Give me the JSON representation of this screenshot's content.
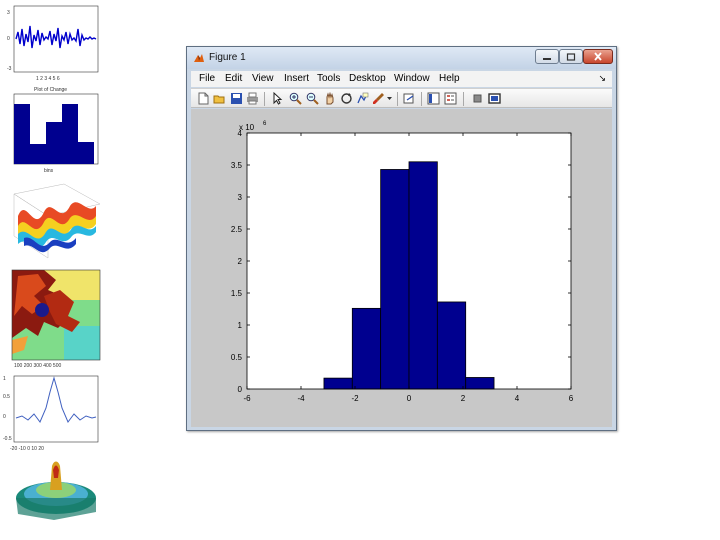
{
  "window": {
    "title": "Figure 1",
    "controls": {
      "minimize": "minimize",
      "maximize": "maximize",
      "close": "close"
    }
  },
  "menu": {
    "items": [
      "File",
      "Edit",
      "View",
      "Insert",
      "Tools",
      "Desktop",
      "Window",
      "Help"
    ],
    "overflow_arrow": "↘"
  },
  "toolbar": {
    "icons": [
      "new-figure-icon",
      "open-file-icon",
      "save-icon",
      "print-icon",
      "pointer-icon",
      "zoom-in-icon",
      "zoom-out-icon",
      "pan-icon",
      "rotate-3d-icon",
      "data-cursor-icon",
      "brush-icon",
      "colorbar-icon",
      "legend-icon",
      "hide-plot-tools-icon",
      "show-plot-tools-icon"
    ]
  },
  "chart_data": {
    "type": "bar",
    "title": "",
    "xlabel": "",
    "ylabel": "",
    "y_exponent_label": "x 10",
    "y_exponent_power": "6",
    "xlim": [
      -6,
      6
    ],
    "ylim": [
      0,
      4
    ],
    "xticks": [
      "-6",
      "-4",
      "-2",
      "0",
      "2",
      "4",
      "6"
    ],
    "yticks": [
      "0",
      "0.5",
      "1",
      "1.5",
      "2",
      "2.5",
      "3",
      "3.5",
      "4"
    ],
    "bin_edges": [
      -4.2,
      -3.15,
      -2.1,
      -1.05,
      0.0,
      1.05,
      2.1,
      3.15,
      4.2
    ],
    "values": [
      0.0,
      0.17,
      1.26,
      3.43,
      3.55,
      1.36,
      0.18,
      0.0
    ],
    "bar_color": "#00008f",
    "grid": false
  },
  "colors": {
    "figure_bg": "#c8c8c8",
    "window_frame": "#c9d6e5",
    "accent_close": "#c8452c"
  }
}
